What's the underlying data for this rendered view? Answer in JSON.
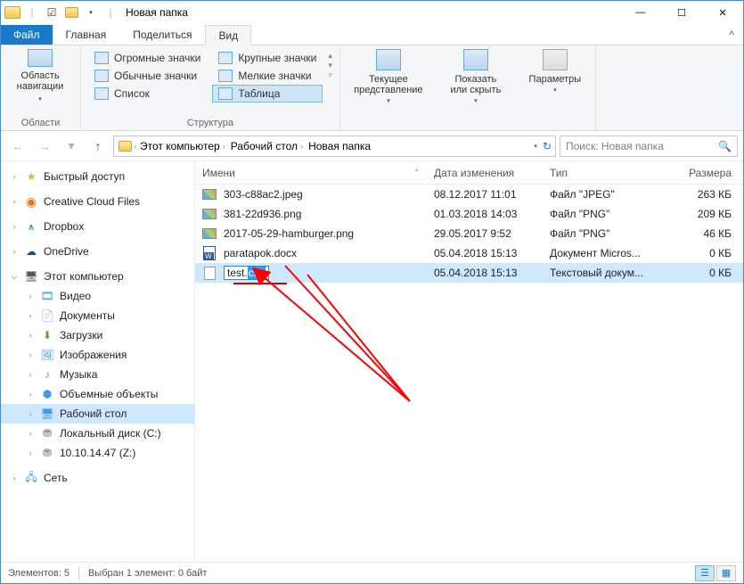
{
  "title": "Новая папка",
  "tabs": {
    "file": "Файл",
    "home": "Главная",
    "share": "Поделиться",
    "view": "Вид"
  },
  "ribbon": {
    "panes": {
      "label": "Область\nнавигации",
      "group": "Области"
    },
    "layout": {
      "huge": "Огромные значки",
      "large": "Крупные значки",
      "normal": "Обычные значки",
      "small": "Мелкие значки",
      "list": "Список",
      "table": "Таблица",
      "group_label": "Структура"
    },
    "view": {
      "current": "Текущее\nпредставление",
      "show": "Показать\nили скрыть",
      "options": "Параметры"
    }
  },
  "breadcrumb": [
    "Этот компьютер",
    "Рабочий стол",
    "Новая папка"
  ],
  "search_placeholder": "Поиск: Новая папка",
  "tree": {
    "quick": "Быстрый доступ",
    "ccf": "Creative Cloud Files",
    "dropbox": "Dropbox",
    "onedrive": "OneDrive",
    "thispc": "Этот компьютер",
    "video": "Видео",
    "documents": "Документы",
    "downloads": "Загрузки",
    "pictures": "Изображения",
    "music": "Музыка",
    "objects3d": "Объемные объекты",
    "desktop": "Рабочий стол",
    "localdisk": "Локальный диск (C:)",
    "netdrive": "10.10.14.47 (Z:)",
    "network": "Сеть"
  },
  "columns": {
    "name": "Имени",
    "date": "Дата изменения",
    "type": "Тип",
    "size": "Размера"
  },
  "files": [
    {
      "name": "303-c88ac2.jpeg",
      "date": "08.12.2017 11:01",
      "type": "Файл \"JPEG\"",
      "size": "263 КБ",
      "ftype": "img"
    },
    {
      "name": "381-22d936.png",
      "date": "01.03.2018 14:03",
      "type": "Файл \"PNG\"",
      "size": "209 КБ",
      "ftype": "img"
    },
    {
      "name": "2017-05-29-hamburger.png",
      "date": "29.05.2017 9:52",
      "type": "Файл \"PNG\"",
      "size": "46 КБ",
      "ftype": "img"
    },
    {
      "name": "paratapok.docx",
      "date": "05.04.2018 15:13",
      "type": "Документ Micros...",
      "size": "0 КБ",
      "ftype": "doc"
    }
  ],
  "rename": {
    "base": "test.",
    "ext": "csv",
    "date": "05.04.2018 15:13",
    "type": "Текстовый докум...",
    "size": "0 КБ"
  },
  "status": {
    "count": "Элементов: 5",
    "selected": "Выбран 1 элемент: 0 байт"
  }
}
